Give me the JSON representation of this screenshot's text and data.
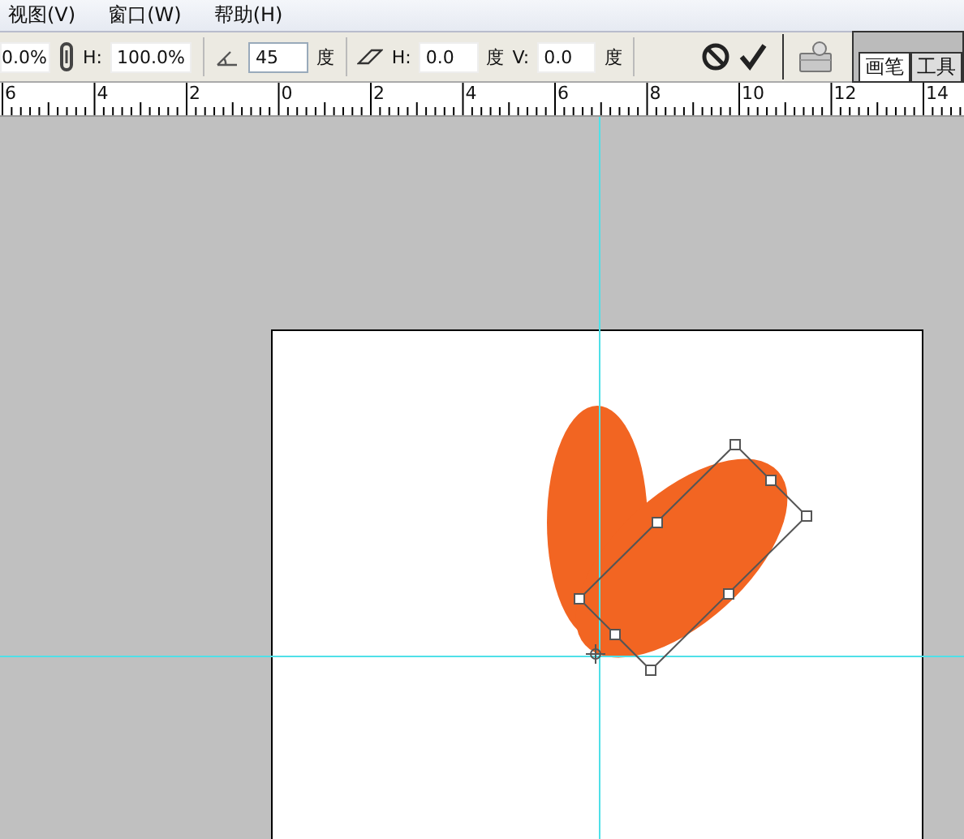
{
  "menu": [
    {
      "label": "视图(V)"
    },
    {
      "label": "窗口(W)"
    },
    {
      "label": "帮助(H)"
    }
  ],
  "options_bar": {
    "width_value": "0.0%",
    "height_label": "H:",
    "height_value": "100.0%",
    "angle_value": "45",
    "angle_unit": "度",
    "skew_h_label": "H:",
    "skew_h_value": "0.0",
    "skew_h_unit": "度",
    "skew_v_label": "V:",
    "skew_v_value": "0.0",
    "skew_v_unit": "度"
  },
  "palette_tabs": [
    {
      "label": "画笔",
      "selected": true
    },
    {
      "label": "工具",
      "selected": false
    }
  ],
  "ruler": {
    "labels": [
      "6",
      "4",
      "2",
      "0",
      "2",
      "4",
      "6",
      "8",
      "10",
      "12",
      "14"
    ]
  }
}
